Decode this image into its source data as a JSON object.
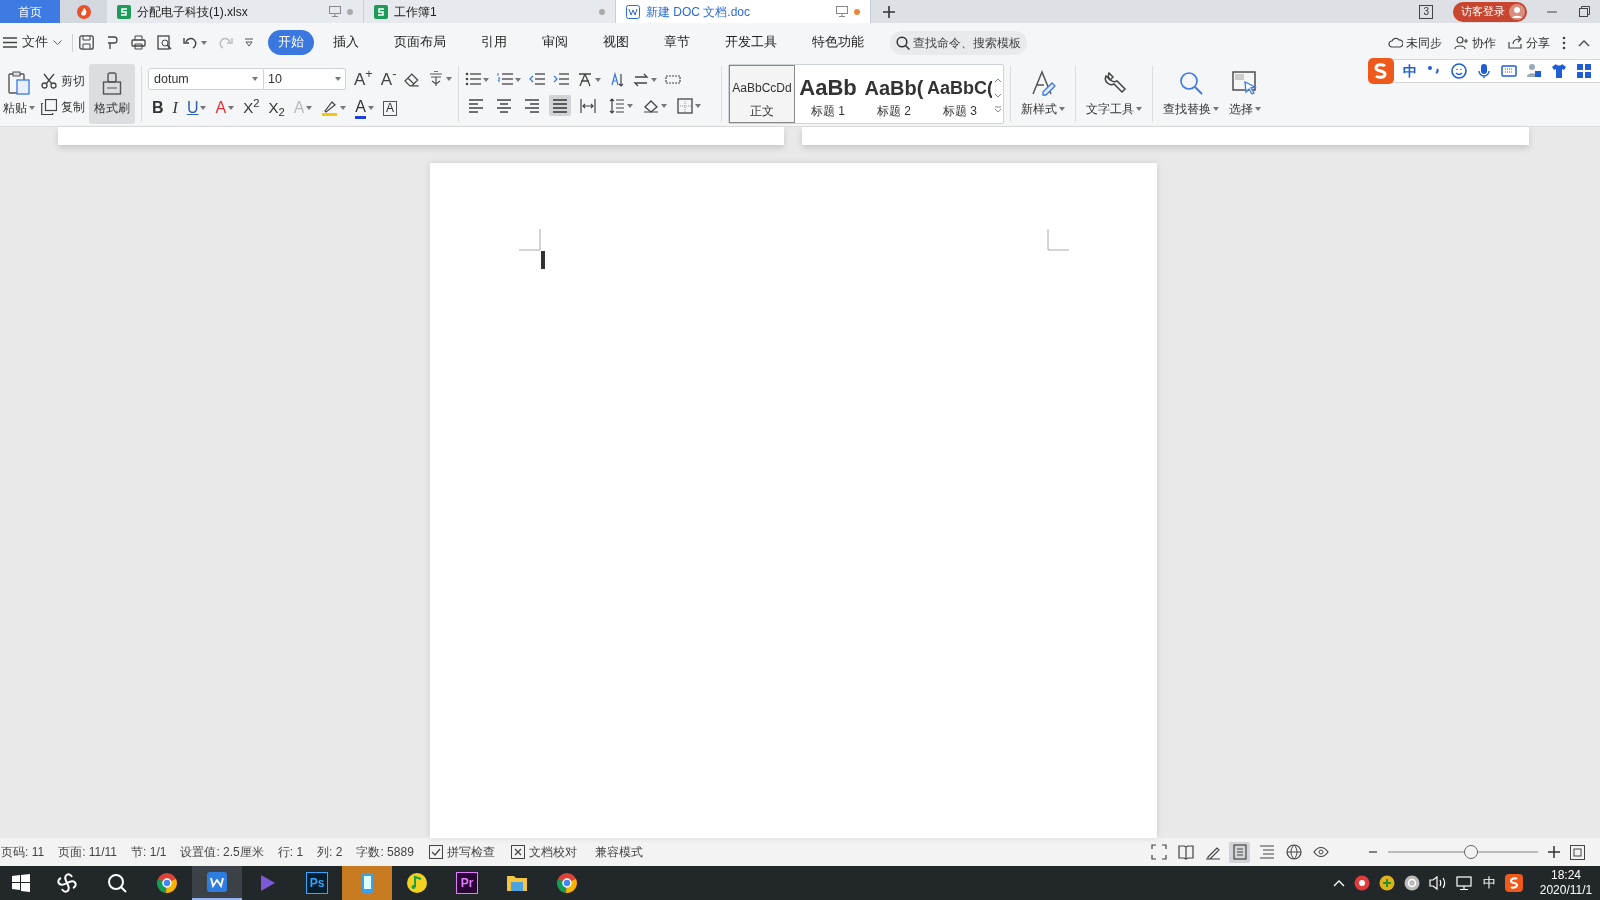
{
  "tabs": [
    {
      "kind": "home",
      "label": "首页",
      "selected": false
    },
    {
      "kind": "logo",
      "selected": false
    },
    {
      "kind": "sheet",
      "label": "分配电子科技(1).xlsx",
      "selected": false
    },
    {
      "kind": "sheet",
      "label": "工作簿1",
      "selected": false
    },
    {
      "kind": "doc",
      "label": "新建 DOC 文档.doc",
      "selected": true
    }
  ],
  "window_count": "3",
  "login": "访客登录",
  "menu": {
    "file": "文件",
    "tabs": [
      {
        "label": "开始",
        "selected": true
      },
      {
        "label": "插入",
        "selected": false
      },
      {
        "label": "页面布局",
        "selected": false
      },
      {
        "label": "引用",
        "selected": false
      },
      {
        "label": "审阅",
        "selected": false
      },
      {
        "label": "视图",
        "selected": false
      },
      {
        "label": "章节",
        "selected": false
      },
      {
        "label": "开发工具",
        "selected": false
      },
      {
        "label": "特色功能",
        "selected": false
      }
    ],
    "search_placeholder": "查找命令、搜索模板",
    "right": [
      {
        "kind": "cloud",
        "label": "未同步"
      },
      {
        "kind": "person",
        "label": "协作"
      },
      {
        "kind": "share",
        "label": "分享"
      }
    ]
  },
  "ime": {
    "mode": "中"
  },
  "ribbon": {
    "paste": "粘贴",
    "cut": "剪切",
    "copy": "复制",
    "format_painter": {
      "label": "格式刷",
      "highlighted": true
    },
    "font": {
      "value": "dotum"
    },
    "font_size": {
      "value": "10"
    },
    "grow": "A$^{+}$",
    "shrink": "A$^{-}$",
    "font_buttons": [
      {
        "kind": "bold",
        "label": "B"
      },
      {
        "kind": "italic",
        "label": "I"
      },
      {
        "kind": "underline",
        "label": "U"
      },
      {
        "kind": "strike",
        "label": "A"
      },
      {
        "kind": "plain",
        "label": "X$^{2}$"
      },
      {
        "kind": "plain",
        "label": "X$_{2}$"
      },
      {
        "kind": "effect",
        "label": "A"
      },
      {
        "kind": "highlight"
      },
      {
        "kind": "color",
        "label": "A"
      },
      {
        "kind": "boxed",
        "label": "A"
      }
    ],
    "alignments": [
      {
        "kind": "left",
        "selected": false
      },
      {
        "kind": "center",
        "selected": false
      },
      {
        "kind": "right",
        "selected": false
      },
      {
        "kind": "justify",
        "selected": true
      },
      {
        "kind": "distributed",
        "selected": false
      }
    ],
    "styles": [
      {
        "preview": "AaBbCcDd",
        "label": "正文",
        "selected": true,
        "kind": "body"
      },
      {
        "preview": "AaBb",
        "label": "标题 1",
        "selected": false,
        "kind": "h1"
      },
      {
        "preview": "AaBb(",
        "label": "标题 2",
        "selected": false,
        "kind": "h2"
      },
      {
        "preview": "AaBbC(",
        "label": "标题 3",
        "selected": false,
        "kind": "h3"
      }
    ],
    "tools": [
      {
        "kind": "newstyle",
        "label": "新样式"
      },
      {
        "kind": "texttools",
        "label": "文字工具"
      },
      {
        "kind": "find",
        "label": "查找替换"
      },
      {
        "kind": "select",
        "label": "选择"
      }
    ]
  },
  "status_bar": {
    "items": [
      "页码: 11",
      "页面: 11/11",
      "节: 1/1",
      "设置值: 2.5厘米",
      "行: 1",
      "列: 2",
      "字数: 5889"
    ],
    "checks": [
      {
        "kind": "check",
        "label": "拼写检查"
      },
      {
        "kind": "cross",
        "label": "文档校对"
      }
    ],
    "mode": "兼容模式",
    "views": [
      {
        "kind": "fullscreen",
        "selected": false
      },
      {
        "kind": "read",
        "selected": false
      },
      {
        "kind": "edit",
        "selected": false
      },
      {
        "kind": "page",
        "selected": true
      },
      {
        "kind": "outline",
        "selected": false
      },
      {
        "kind": "web",
        "selected": false
      },
      {
        "kind": "eye",
        "selected": false
      }
    ],
    "zoom": {
      "level": 0.55
    }
  },
  "taskbar": {
    "apps": [
      {
        "kind": "pinwheel",
        "selected": false,
        "flashing": false
      },
      {
        "kind": "search",
        "selected": false,
        "flashing": false
      },
      {
        "kind": "chrome",
        "selected": false,
        "flashing": false
      },
      {
        "kind": "writer",
        "selected": true,
        "flashing": false
      },
      {
        "kind": "play",
        "selected": false,
        "flashing": false
      },
      {
        "kind": "ps",
        "label": "Ps",
        "selected": false,
        "flashing": false
      },
      {
        "kind": "phone",
        "selected": false,
        "flashing": true
      },
      {
        "kind": "music",
        "selected": false,
        "flashing": false
      },
      {
        "kind": "pr",
        "label": "Pr",
        "selected": false,
        "flashing": false
      },
      {
        "kind": "folder",
        "selected": false,
        "flashing": false
      },
      {
        "kind": "chrome",
        "selected": false,
        "flashing": false
      }
    ],
    "ime": "中",
    "time": "18:24",
    "date": "2020/11/1"
  }
}
